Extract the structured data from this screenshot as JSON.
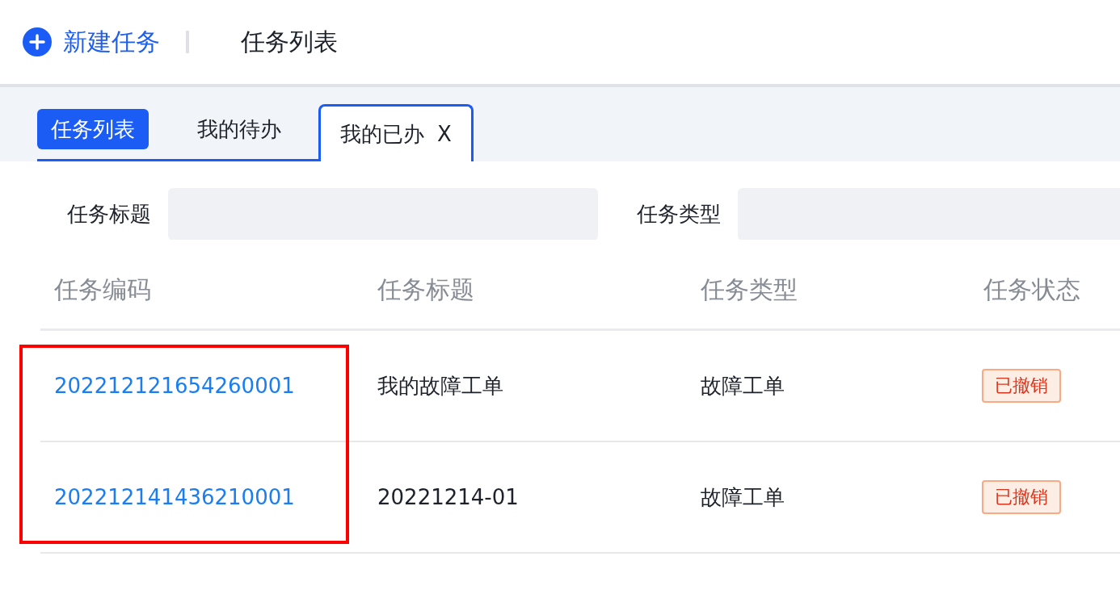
{
  "header": {
    "new_button": "新建任务",
    "title": "任务列表"
  },
  "tabs": [
    {
      "label": "任务列表",
      "kind": "pinned",
      "selected": false
    },
    {
      "label": "我的待办",
      "kind": "plain",
      "selected": false
    },
    {
      "label": "我的已办",
      "kind": "plain",
      "selected": true,
      "close": "X"
    }
  ],
  "filters": [
    {
      "label": "任务标题"
    },
    {
      "label": "任务类型"
    }
  ],
  "table": {
    "columns": [
      {
        "label": "任务编码",
        "highlighted": true
      },
      {
        "label": "任务标题"
      },
      {
        "label": "任务类型"
      },
      {
        "label": "任务状态"
      }
    ],
    "rows": [
      {
        "code": "202212121654260001",
        "title": "我的故障工单",
        "type": "故障工单",
        "status": "已撤销"
      },
      {
        "code": "202212141436210001",
        "title": "20221214-01",
        "type": "故障工单",
        "status": "已撤销"
      }
    ]
  }
}
